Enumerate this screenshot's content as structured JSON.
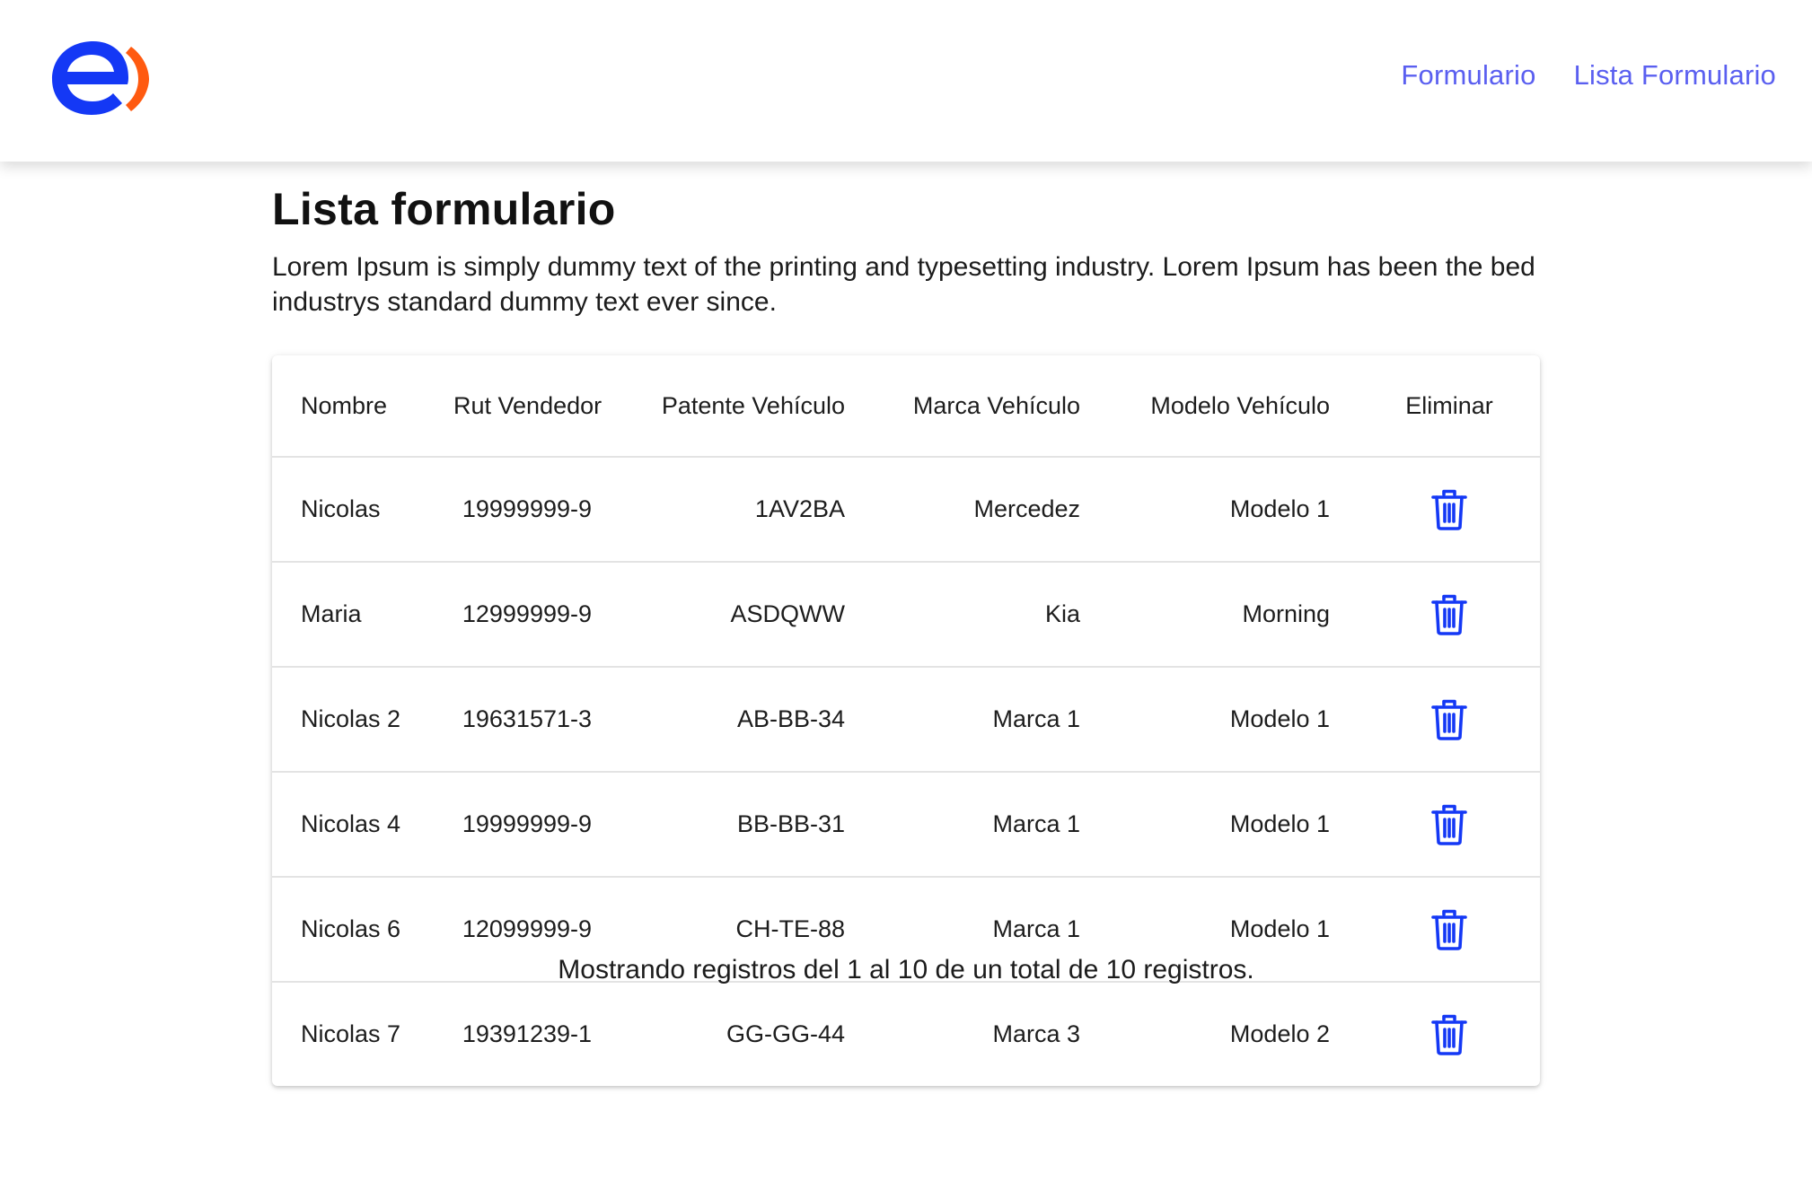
{
  "header": {
    "nav": [
      {
        "label": "Formulario"
      },
      {
        "label": "Lista Formulario"
      }
    ],
    "logo_colors": {
      "letter": "#1438f5",
      "arc": "#ff5a10"
    }
  },
  "page": {
    "title": "Lista formulario",
    "description": "Lorem Ipsum is simply dummy text of the printing and typesetting industry. Lorem Ipsum has been the bed industrys standard dummy text ever since."
  },
  "table": {
    "columns": [
      "Nombre",
      "Rut Vendedor",
      "Patente Vehículo",
      "Marca Vehículo",
      "Modelo Vehículo",
      "Eliminar"
    ],
    "rows": [
      {
        "nombre": "Nicolas",
        "rut": "19999999-9",
        "patente": "1AV2BA",
        "marca": "Mercedez",
        "modelo": "Modelo 1",
        "action_icon": "trash-icon"
      },
      {
        "nombre": "Maria",
        "rut": "12999999-9",
        "patente": "ASDQWW",
        "marca": "Kia",
        "modelo": "Morning",
        "action_icon": "trash-icon"
      },
      {
        "nombre": "Nicolas 2",
        "rut": "19631571-3",
        "patente": "AB-BB-34",
        "marca": "Marca 1",
        "modelo": "Modelo 1",
        "action_icon": "trash-icon"
      },
      {
        "nombre": "Nicolas 4",
        "rut": "19999999-9",
        "patente": "BB-BB-31",
        "marca": "Marca 1",
        "modelo": "Modelo 1",
        "action_icon": "trash-icon"
      },
      {
        "nombre": "Nicolas 6",
        "rut": "12099999-9",
        "patente": "CH-TE-88",
        "marca": "Marca 1",
        "modelo": "Modelo 1",
        "action_icon": "trash-icon"
      },
      {
        "nombre": "Nicolas 7",
        "rut": "19391239-1",
        "patente": "GG-GG-44",
        "marca": "Marca 3",
        "modelo": "Modelo 2",
        "action_icon": "trash-icon"
      }
    ],
    "icon_color": "#1438f5"
  },
  "footer": {
    "summary": "Mostrando registros del 1 al 10 de un total de 10 registros."
  },
  "colors": {
    "nav_link": "#5a5ff0",
    "accent": "#1438f5"
  }
}
